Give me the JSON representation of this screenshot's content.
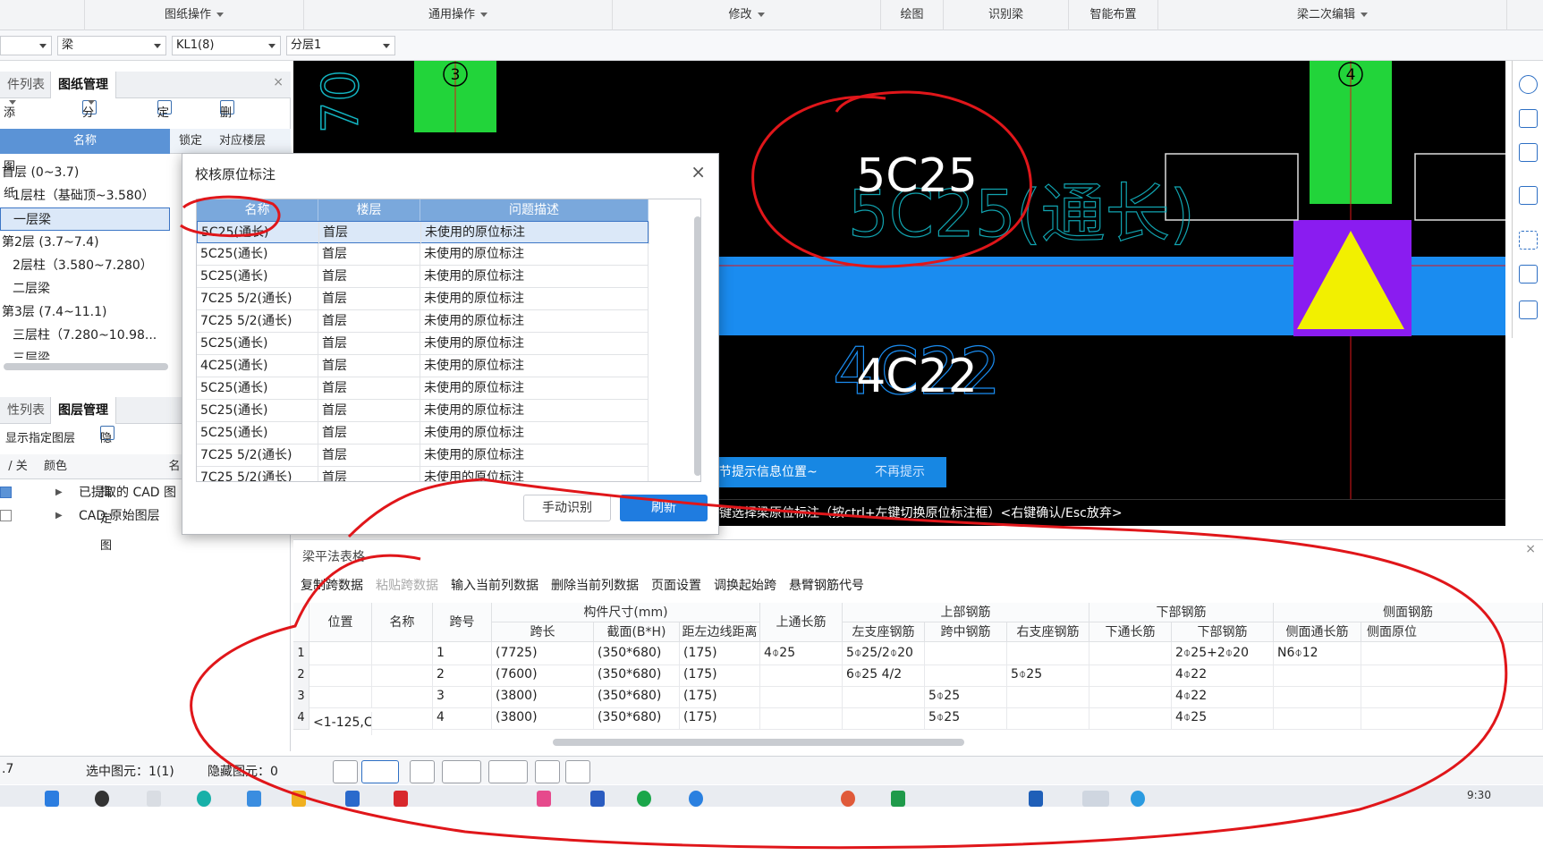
{
  "ribbon": {
    "groups": [
      "图纸操作",
      "通用操作",
      "修改",
      "绘图",
      "识别梁",
      "智能布置",
      "梁二次编辑"
    ]
  },
  "selectors": {
    "s1": "",
    "s2": "梁",
    "s3": "KL1(8)",
    "s4": "分层1"
  },
  "left_panel": {
    "tab_top": [
      "件列表",
      "图纸管理"
    ],
    "toolbar_top": {
      "add": "添加图纸",
      "split": "分割",
      "locate": "定位",
      "delete": "删除"
    },
    "tree_header": {
      "name": "名称",
      "lock": "锁定",
      "floor": "对应楼层"
    },
    "tree_rows": [
      "首层 (0~3.7)",
      "1层柱（基础顶~3.580）",
      "一层梁",
      "第2层 (3.7~7.4)",
      "2层柱（3.580~7.280）",
      "二层梁",
      "第3层 (7.4~11.1)",
      "三层柱（7.280~10.98...",
      "三层梁"
    ],
    "tab_bottom": [
      "性列表",
      "图层管理"
    ],
    "toolbar_bottom": {
      "show": "显示指定图层",
      "hide": "隐藏指定图"
    },
    "layer_header": {
      "onoff": "/ 关",
      "color": "颜色",
      "name": "名"
    },
    "layer_rows": [
      "已提取的 CAD 图",
      "CAD 原始图层"
    ]
  },
  "cad": {
    "axis_left": "3",
    "axis_right": "4",
    "label_top": "5C25",
    "label_top_ghost": "5C25(通长)",
    "label_bottom": "4C22",
    "label_bottom_ghost": "4C22",
    "partial_vertical": "70",
    "tip_text": "标可调节提示信息位置~",
    "tip_dismiss": "不再提示",
    "command_line": "键选择梁原位标注（按ctrl+左键切换原位标注框）<右键确认/Esc放弃>"
  },
  "dialog": {
    "title": "校核原位标注",
    "close": "×",
    "columns": [
      "名称",
      "楼层",
      "问题描述"
    ],
    "rows": [
      [
        "5C25(通长)",
        "首层",
        "未使用的原位标注"
      ],
      [
        "5C25(通长)",
        "首层",
        "未使用的原位标注"
      ],
      [
        "5C25(通长)",
        "首层",
        "未使用的原位标注"
      ],
      [
        "7C25 5/2(通长)",
        "首层",
        "未使用的原位标注"
      ],
      [
        "7C25 5/2(通长)",
        "首层",
        "未使用的原位标注"
      ],
      [
        "5C25(通长)",
        "首层",
        "未使用的原位标注"
      ],
      [
        "4C25(通长)",
        "首层",
        "未使用的原位标注"
      ],
      [
        "5C25(通长)",
        "首层",
        "未使用的原位标注"
      ],
      [
        "5C25(通长)",
        "首层",
        "未使用的原位标注"
      ],
      [
        "5C25(通长)",
        "首层",
        "未使用的原位标注"
      ],
      [
        "7C25 5/2(通长)",
        "首层",
        "未使用的原位标注"
      ],
      [
        "7C25 5/2(通长)",
        "首层",
        "未使用的原位标注"
      ]
    ],
    "btn_manual": "手动识别",
    "btn_refresh": "刷新"
  },
  "beam_table": {
    "title": "梁平法表格",
    "toolbar": [
      "复制跨数据",
      "粘贴跨数据",
      "输入当前列数据",
      "删除当前列数据",
      "页面设置",
      "调换起始跨",
      "悬臂钢筋代号"
    ],
    "toolbar_disabled": [
      false,
      true,
      false,
      false,
      false,
      false,
      false
    ],
    "header_top": {
      "size": "构件尺寸(mm)",
      "top": "上部钢筋",
      "bottom": "下部钢筋",
      "side": "侧面钢筋"
    },
    "header": {
      "pos": "位置",
      "name": "名称",
      "span": "跨号",
      "span_len": "跨长",
      "section": "截面(B*H)",
      "dist": "距左边线距离",
      "top_long": "上通长筋",
      "left_sup": "左支座钢筋",
      "mid": "跨中钢筋",
      "right_sup": "右支座钢筋",
      "bot_long": "下通长筋",
      "bot": "下部钢筋",
      "side_long": "侧面通长筋",
      "side_orig": "侧面原位"
    },
    "position_value": "<1-125,C",
    "rows": [
      {
        "n": "1",
        "span": "1",
        "len": "(7725)",
        "sec": "(350*680)",
        "dist": "(175)",
        "top_long": "4⌽25",
        "left_sup": "5⌽25/2⌽20",
        "mid": "",
        "right_sup": "",
        "bot_long": "",
        "bot": "2⌽25+2⌽20",
        "side_long": "N6⌽12"
      },
      {
        "n": "2",
        "span": "2",
        "len": "(7600)",
        "sec": "(350*680)",
        "dist": "(175)",
        "top_long": "",
        "left_sup": "6⌽25 4/2",
        "mid": "",
        "right_sup": "5⌽25",
        "bot_long": "",
        "bot": "4⌽22",
        "side_long": ""
      },
      {
        "n": "3",
        "span": "3",
        "len": "(3800)",
        "sec": "(350*680)",
        "dist": "(175)",
        "top_long": "",
        "left_sup": "",
        "mid": "5⌽25",
        "right_sup": "",
        "bot_long": "",
        "bot": "4⌽22",
        "side_long": ""
      },
      {
        "n": "4",
        "span": "4",
        "len": "(3800)",
        "sec": "(350*680)",
        "dist": "(175)",
        "top_long": "",
        "left_sup": "",
        "mid": "5⌽25",
        "right_sup": "",
        "bot_long": "",
        "bot": "4⌽25",
        "side_long": ""
      }
    ]
  },
  "status": {
    "left_value": ".7",
    "selected": "选中图元：1(1)",
    "hidden": "隐藏图元：0"
  },
  "taskbar": {
    "clock": "9:30"
  },
  "colors": {
    "column_green": "#22d43a",
    "beam_blue": "#1a8cf0",
    "support_purple": "#8a1cf0",
    "support_yellow": "#f2f000",
    "accent_blue": "#1f7ce0",
    "annotation_red": "#e0161a"
  }
}
